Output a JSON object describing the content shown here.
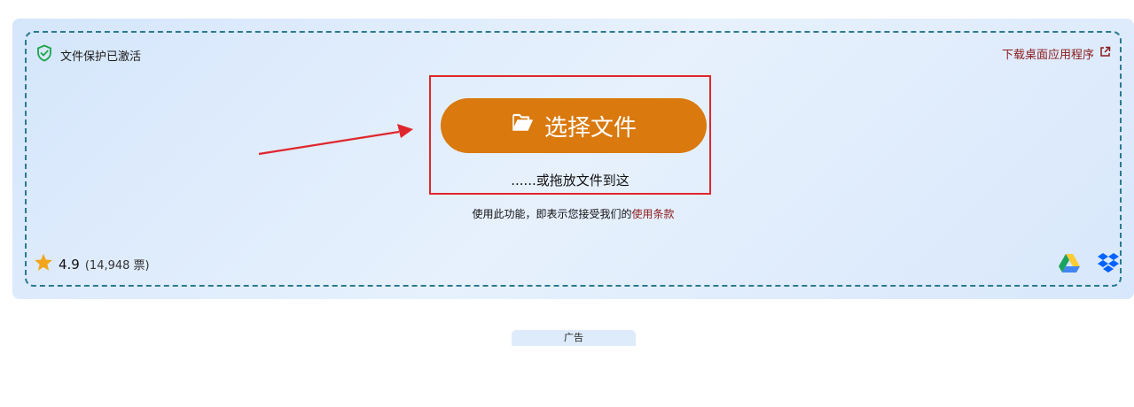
{
  "protection": {
    "label": "文件保护已激活"
  },
  "desktop_app": {
    "label": "下载桌面应用程序"
  },
  "upload": {
    "choose_button": "选择文件",
    "drop_text": "......或拖放文件到这"
  },
  "terms": {
    "prefix": "使用此功能，即表示您接受我们的",
    "link": "使用条款"
  },
  "rating": {
    "score": "4.9",
    "votes": "(14,948 票)"
  },
  "cloud_services": [
    "google-drive-icon",
    "dropbox-icon"
  ],
  "ad": {
    "label": "广告"
  },
  "colors": {
    "accent": "#d9790e",
    "highlight_border": "#e0262d",
    "link": "#8a1a1a",
    "panel": "#dde9fb"
  }
}
